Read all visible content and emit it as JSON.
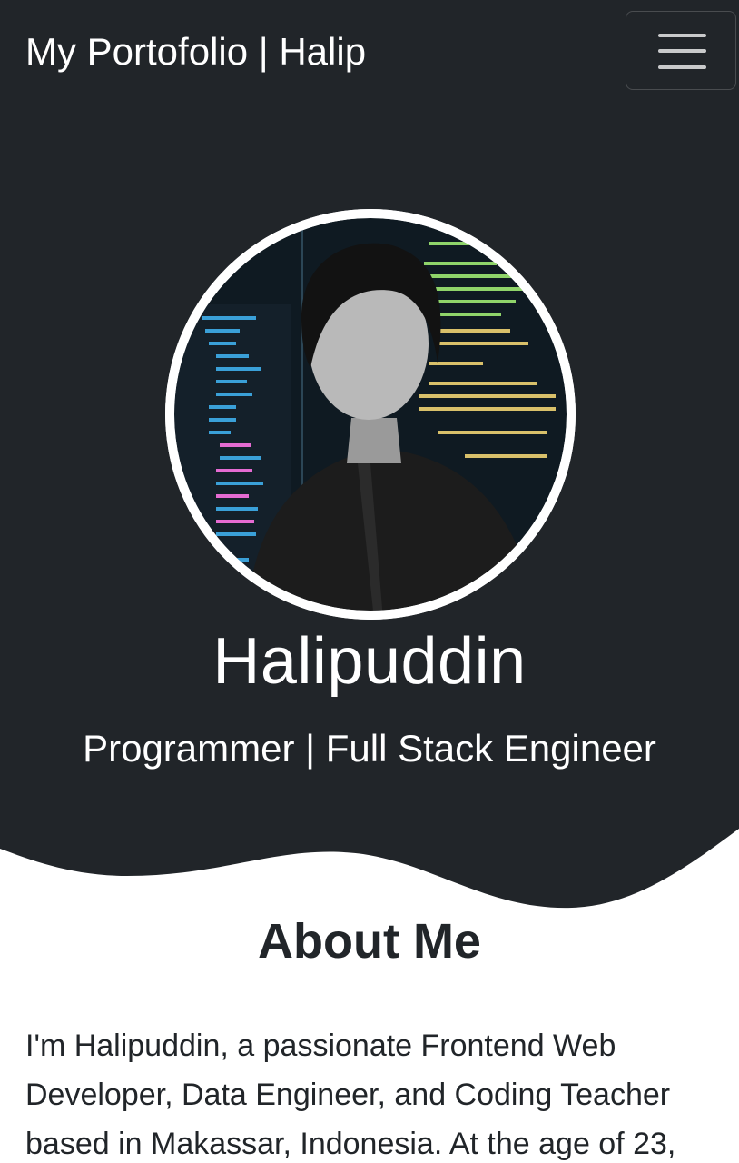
{
  "navbar": {
    "brand": "My Portofolio | Halip",
    "toggle_icon": "hamburger-menu-icon"
  },
  "hero": {
    "photo_icon": "profile-photo",
    "name": "Halipuddin",
    "role": "Programmer | Full Stack Engineer"
  },
  "about": {
    "title": "About Me",
    "text": "I'm Halipuddin, a passionate Frontend Web Developer, Data Engineer, and Coding Teacher based in Makassar, Indonesia. At the age of 23,"
  },
  "colors": {
    "dark": "#212529",
    "light": "#ffffff",
    "text": "#212529"
  }
}
